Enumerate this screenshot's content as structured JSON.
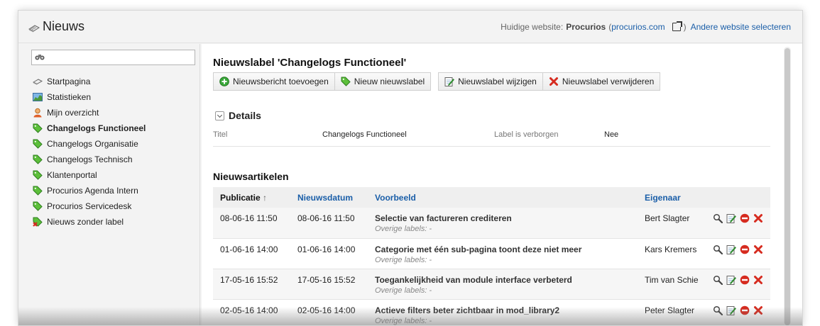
{
  "header": {
    "app_title": "Nieuws",
    "site_prefix": "Huidige website:",
    "site_name": "Procurios",
    "site_open_paren": "(",
    "site_url": "procurios.com",
    "site_close_paren": ")",
    "change_site": "Andere website selecteren"
  },
  "sidebar": {
    "search": {
      "value": "",
      "placeholder": ""
    },
    "items": [
      {
        "label": "Startpagina",
        "icon": "news-paper-icon"
      },
      {
        "label": "Statistieken",
        "icon": "chart-icon"
      },
      {
        "label": "Mijn overzicht",
        "icon": "user-icon"
      },
      {
        "label": "Changelogs Functioneel",
        "icon": "tag-icon",
        "active": true
      },
      {
        "label": "Changelogs Organisatie",
        "icon": "tag-icon"
      },
      {
        "label": "Changelogs Technisch",
        "icon": "tag-icon"
      },
      {
        "label": "Klantenportal",
        "icon": "tag-icon"
      },
      {
        "label": "Procurios Agenda Intern",
        "icon": "tag-icon"
      },
      {
        "label": "Procurios Servicedesk",
        "icon": "tag-icon"
      },
      {
        "label": "Nieuws zonder label",
        "icon": "tag-remove-icon"
      }
    ]
  },
  "main": {
    "title": "Nieuwslabel 'Changelogs Functioneel'",
    "toolbar": {
      "add_article": "Nieuwsbericht toevoegen",
      "new_label": "Nieuw nieuwslabel",
      "edit_label": "Nieuwslabel wijzigen",
      "delete_label": "Nieuwslabel verwijderen"
    },
    "details": {
      "heading": "Details",
      "title_label": "Titel",
      "title_value": "Changelogs Functioneel",
      "hidden_label": "Label is verborgen",
      "hidden_value": "Nee"
    },
    "articles": {
      "heading": "Nieuwsartikelen",
      "columns": {
        "publication": "Publicatie",
        "sort_arrow": "↑",
        "news_date": "Nieuwsdatum",
        "preview": "Voorbeeld",
        "owner": "Eigenaar"
      },
      "rows": [
        {
          "publication": "08-06-16 11:50",
          "news_date": "08-06-16 11:50",
          "title": "Selectie van factureren crediteren",
          "sub": "Overige labels: -",
          "owner": "Bert Slagter"
        },
        {
          "publication": "01-06-16 14:00",
          "news_date": "01-06-16 14:00",
          "title": "Categorie met één sub-pagina toont deze niet meer",
          "sub": "Overige labels: -",
          "owner": "Kars Kremers"
        },
        {
          "publication": "17-05-16 15:52",
          "news_date": "17-05-16 15:52",
          "title": "Toegankelijkheid van module interface verbeterd",
          "sub": "Overige labels: -",
          "owner": "Tim van Schie"
        },
        {
          "publication": "02-05-16 14:00",
          "news_date": "02-05-16 14:00",
          "title": "Actieve filters beter zichtbaar in mod_library2",
          "sub": "Overige labels: -",
          "owner": "Peter Slagter"
        }
      ]
    }
  },
  "colors": {
    "link": "#1a5ea8",
    "tag_green": "#3aa83a",
    "delete_red": "#d62b1f"
  }
}
